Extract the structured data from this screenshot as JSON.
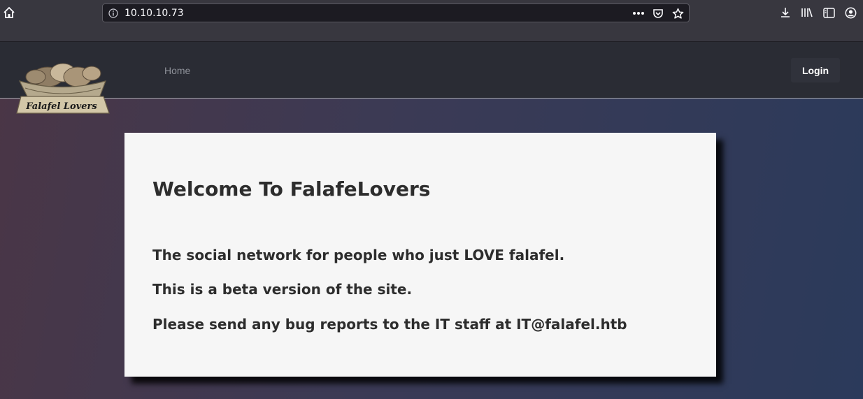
{
  "browser": {
    "url": "10.10.10.73",
    "icons": [
      "home-icon",
      "info-icon",
      "more-dots-icon",
      "pocket-icon",
      "bookmark-star-icon",
      "download-icon",
      "library-icon",
      "sidebar-icon",
      "account-icon"
    ]
  },
  "nav": {
    "logo_text": "Falafel Lovers",
    "home_label": "Home",
    "login_label": "Login"
  },
  "main": {
    "title": "Welcome To FalafeLovers",
    "line1": "The social network for people who just LOVE falafel.",
    "line2": "This is a beta version of the site.",
    "line3": "Please send any bug reports to the IT staff at IT@falafel.htb"
  },
  "colors": {
    "nav_bg": "#2a2c34",
    "card_bg": "#f6f6f6",
    "text": "#2d2d2d"
  }
}
